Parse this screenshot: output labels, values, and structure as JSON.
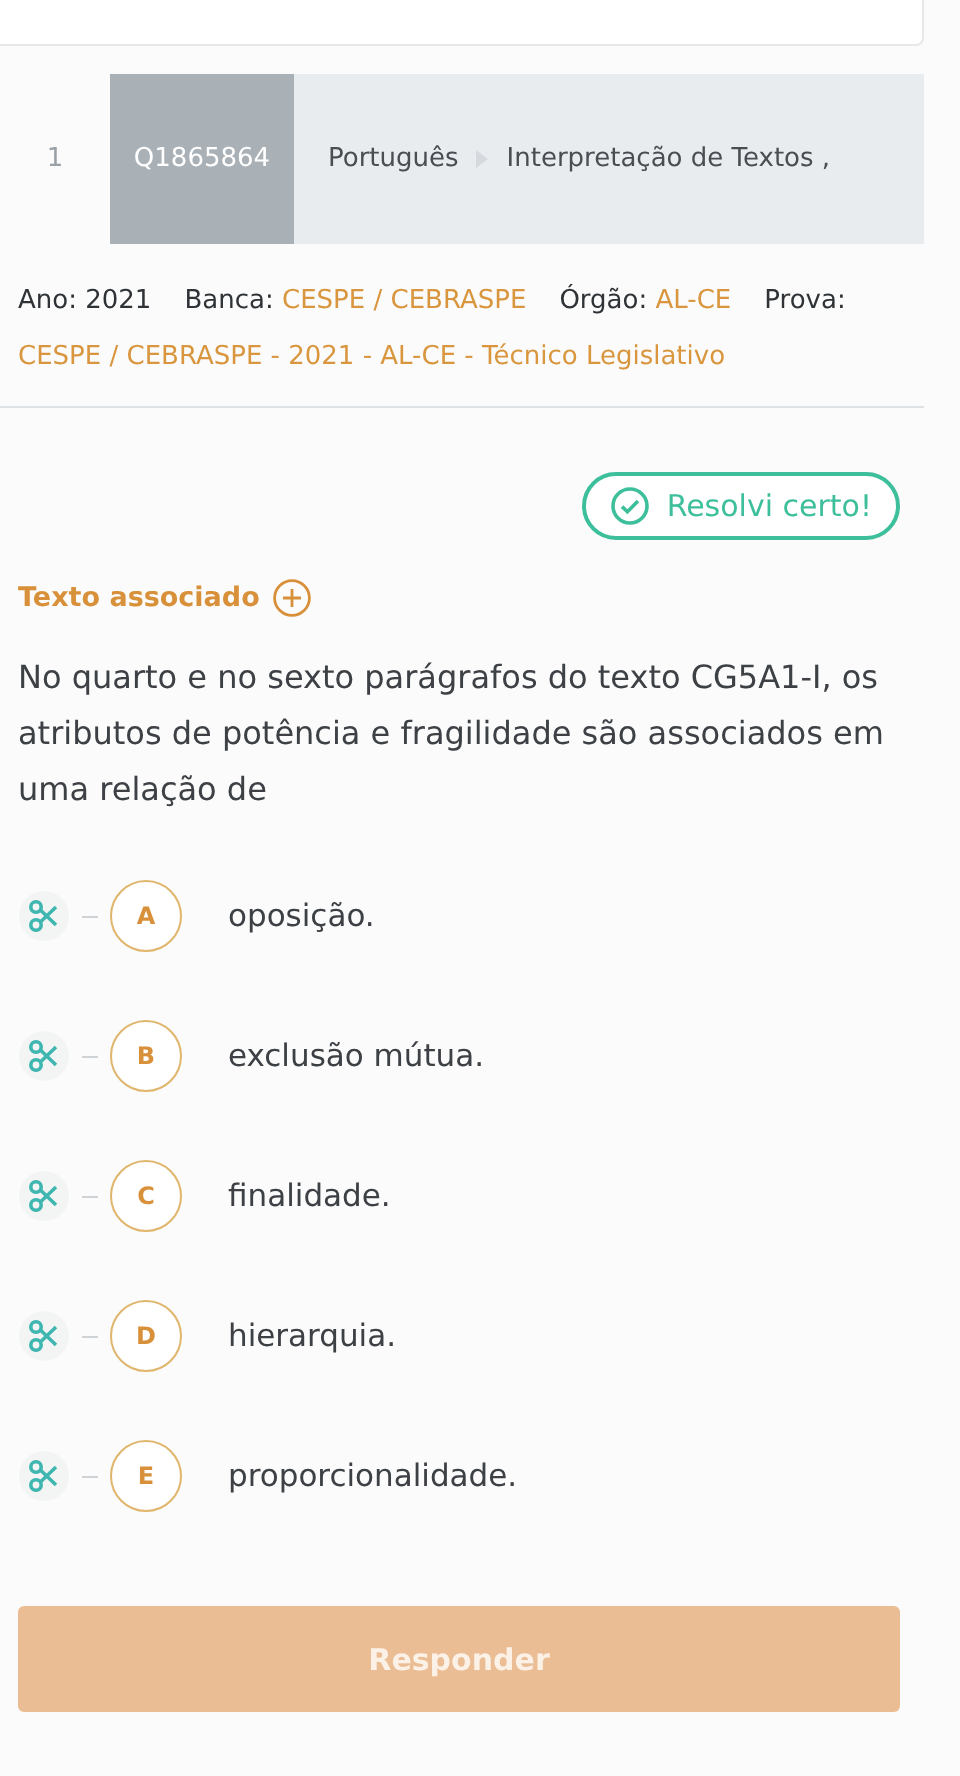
{
  "header": {
    "number": "1",
    "question_id": "Q1865864",
    "breadcrumb": [
      "Português",
      "Interpretação de Textos ,"
    ]
  },
  "meta": [
    {
      "label": "Ano:",
      "value": "2021",
      "highlight": false
    },
    {
      "label": "Banca:",
      "value": "CESPE / CEBRASPE",
      "highlight": true
    },
    {
      "label": "Órgão:",
      "value": "AL-CE",
      "highlight": true
    },
    {
      "label": "Prova:"
    }
  ],
  "exam": "CESPE / CEBRASPE - 2021 - AL-CE - Técnico Legislativo",
  "result_badge": "Resolvi certo!",
  "associated_text": "Texto associado",
  "question": "No quarto e no sexto parágrafos do texto CG5A1-I, os atributos de potência e fragilidade são associados em uma relação de",
  "options": [
    {
      "letter": "A",
      "text": "oposição.",
      "selected": false
    },
    {
      "letter": "B",
      "text": "exclusão mútua.",
      "selected": false
    },
    {
      "letter": "C",
      "text": "finalidade.",
      "selected": false
    },
    {
      "letter": "D",
      "text": "hierarquia.",
      "selected": false
    },
    {
      "letter": "E",
      "text": "proporcionalidade.",
      "selected": false
    }
  ],
  "submit": {
    "label": "Responder",
    "disabled": true
  }
}
